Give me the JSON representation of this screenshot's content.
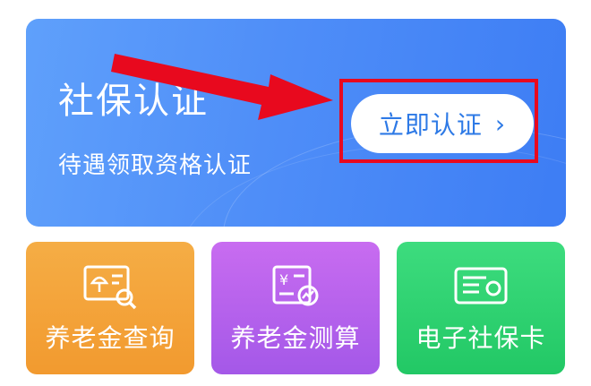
{
  "banner": {
    "title": "社保认证",
    "subtitle": "待遇领取资格认证",
    "button_label": "立即认证",
    "button_chevron": "›"
  },
  "cards": [
    {
      "label": "养老金查询",
      "icon": "pension-query-icon"
    },
    {
      "label": "养老金测算",
      "icon": "pension-calculator-icon"
    },
    {
      "label": "电子社保卡",
      "icon": "social-security-card-icon"
    }
  ],
  "colors": {
    "banner_blue": "#4f8ef8",
    "button_text": "#2e7ae6",
    "annotation_red": "#e8091e",
    "card_orange": "#f29a2f",
    "card_purple": "#a458e8",
    "card_green": "#22c865"
  }
}
